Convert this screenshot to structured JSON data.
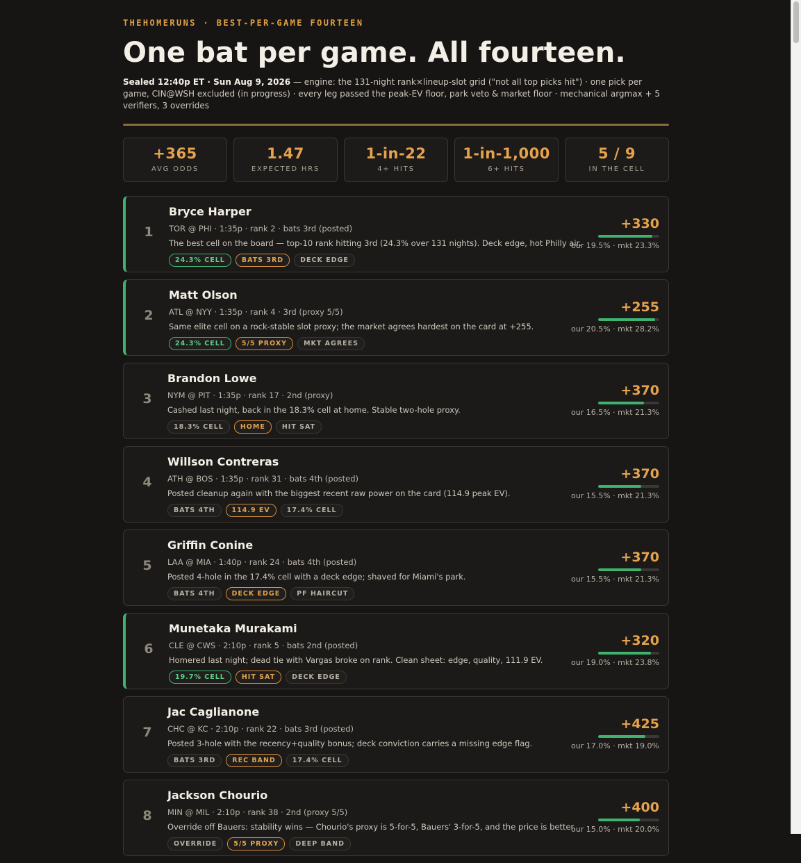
{
  "header": {
    "eyebrow": "THEHOMERUNS · BEST-PER-GAME FOURTEEN",
    "title": "One bat per game. All fourteen.",
    "sealed": "Sealed 12:40p ET · Sun Aug 9, 2026",
    "meta_rest": " — engine: the 131-night rank×lineup-slot grid (\"not all top picks hit\") · one pick per game, CIN@WSH excluded (in progress) · every leg passed the peak-EV floor, park veto & market floor · mechanical argmax + 5 verifiers, 3 overrides"
  },
  "stats": [
    {
      "value": "+365",
      "label": "AVG ODDS"
    },
    {
      "value": "1.47",
      "label": "EXPECTED HRS"
    },
    {
      "value": "1-in-22",
      "label": "4+ HITS"
    },
    {
      "value": "1-in-1,000",
      "label": "6+ HITS"
    },
    {
      "value": "5 / 9",
      "label": "IN THE CELL"
    }
  ],
  "picks": [
    {
      "rank": "1",
      "accent": true,
      "name": "Bryce Harper",
      "game": "TOR @ PHI · 1:35p · rank 2 · bats 3rd (posted)",
      "note": "The best cell on the board — top-10 rank hitting 3rd (24.3% over 131 nights). Deck edge, hot Philly air.",
      "tags": [
        {
          "label": "24.3% CELL",
          "style": "green"
        },
        {
          "label": "BATS 3RD",
          "style": "orange"
        },
        {
          "label": "DECK EDGE",
          "style": "plain"
        }
      ],
      "odds": "+330",
      "probs": "our 19.5% · mkt 23.3%",
      "our_pct": 19.5
    },
    {
      "rank": "2",
      "accent": true,
      "name": "Matt Olson",
      "game": "ATL @ NYY · 1:35p · rank 4 · 3rd (proxy 5/5)",
      "note": "Same elite cell on a rock-stable slot proxy; the market agrees hardest on the card at +255.",
      "tags": [
        {
          "label": "24.3% CELL",
          "style": "green"
        },
        {
          "label": "5/5 PROXY",
          "style": "orange"
        },
        {
          "label": "MKT AGREES",
          "style": "plain"
        }
      ],
      "odds": "+255",
      "probs": "our 20.5% · mkt 28.2%",
      "our_pct": 20.5
    },
    {
      "rank": "3",
      "accent": false,
      "name": "Brandon Lowe",
      "game": "NYM @ PIT · 1:35p · rank 17 · 2nd (proxy)",
      "note": "Cashed last night, back in the 18.3% cell at home. Stable two-hole proxy.",
      "tags": [
        {
          "label": "18.3% CELL",
          "style": "plain"
        },
        {
          "label": "HOME",
          "style": "orange"
        },
        {
          "label": "HIT SAT",
          "style": "plain"
        }
      ],
      "odds": "+370",
      "probs": "our 16.5% · mkt 21.3%",
      "our_pct": 16.5
    },
    {
      "rank": "4",
      "accent": false,
      "name": "Willson Contreras",
      "game": "ATH @ BOS · 1:35p · rank 31 · bats 4th (posted)",
      "note": "Posted cleanup again with the biggest recent raw power on the card (114.9 peak EV).",
      "tags": [
        {
          "label": "BATS 4TH",
          "style": "plain"
        },
        {
          "label": "114.9 EV",
          "style": "orange"
        },
        {
          "label": "17.4% CELL",
          "style": "plain"
        }
      ],
      "odds": "+370",
      "probs": "our 15.5% · mkt 21.3%",
      "our_pct": 15.5
    },
    {
      "rank": "5",
      "accent": false,
      "name": "Griffin Conine",
      "game": "LAA @ MIA · 1:40p · rank 24 · bats 4th (posted)",
      "note": "Posted 4-hole in the 17.4% cell with a deck edge; shaved for Miami's park.",
      "tags": [
        {
          "label": "BATS 4TH",
          "style": "plain"
        },
        {
          "label": "DECK EDGE",
          "style": "orange"
        },
        {
          "label": "PF HAIRCUT",
          "style": "plain"
        }
      ],
      "odds": "+370",
      "probs": "our 15.5% · mkt 21.3%",
      "our_pct": 15.5
    },
    {
      "rank": "6",
      "accent": true,
      "name": "Munetaka Murakami",
      "game": "CLE @ CWS · 2:10p · rank 5 · bats 2nd (posted)",
      "note": "Homered last night; dead tie with Vargas broke on rank. Clean sheet: edge, quality, 111.9 EV.",
      "tags": [
        {
          "label": "19.7% CELL",
          "style": "green"
        },
        {
          "label": "HIT SAT",
          "style": "orange"
        },
        {
          "label": "DECK EDGE",
          "style": "plain"
        }
      ],
      "odds": "+320",
      "probs": "our 19.0% · mkt 23.8%",
      "our_pct": 19.0
    },
    {
      "rank": "7",
      "accent": false,
      "name": "Jac Caglianone",
      "game": "CHC @ KC · 2:10p · rank 22 · bats 3rd (posted)",
      "note": "Posted 3-hole with the recency+quality bonus; deck conviction carries a missing edge flag.",
      "tags": [
        {
          "label": "BATS 3RD",
          "style": "plain"
        },
        {
          "label": "REC BAND",
          "style": "orange"
        },
        {
          "label": "17.4% CELL",
          "style": "plain"
        }
      ],
      "odds": "+425",
      "probs": "our 17.0% · mkt 19.0%",
      "our_pct": 17.0
    },
    {
      "rank": "8",
      "accent": false,
      "name": "Jackson Chourio",
      "game": "MIN @ MIL · 2:10p · rank 38 · 2nd (proxy 5/5)",
      "note": "Override off Bauers: stability wins — Chourio's proxy is 5-for-5, Bauers' 3-for-5, and the price is better.",
      "tags": [
        {
          "label": "OVERRIDE",
          "style": "plain"
        },
        {
          "label": "5/5 PROXY",
          "style": "orange"
        },
        {
          "label": "DEEP BAND",
          "style": "plain"
        }
      ],
      "odds": "+400",
      "probs": "our 15.0% · mkt 20.0%",
      "our_pct": 15.0
    }
  ]
}
